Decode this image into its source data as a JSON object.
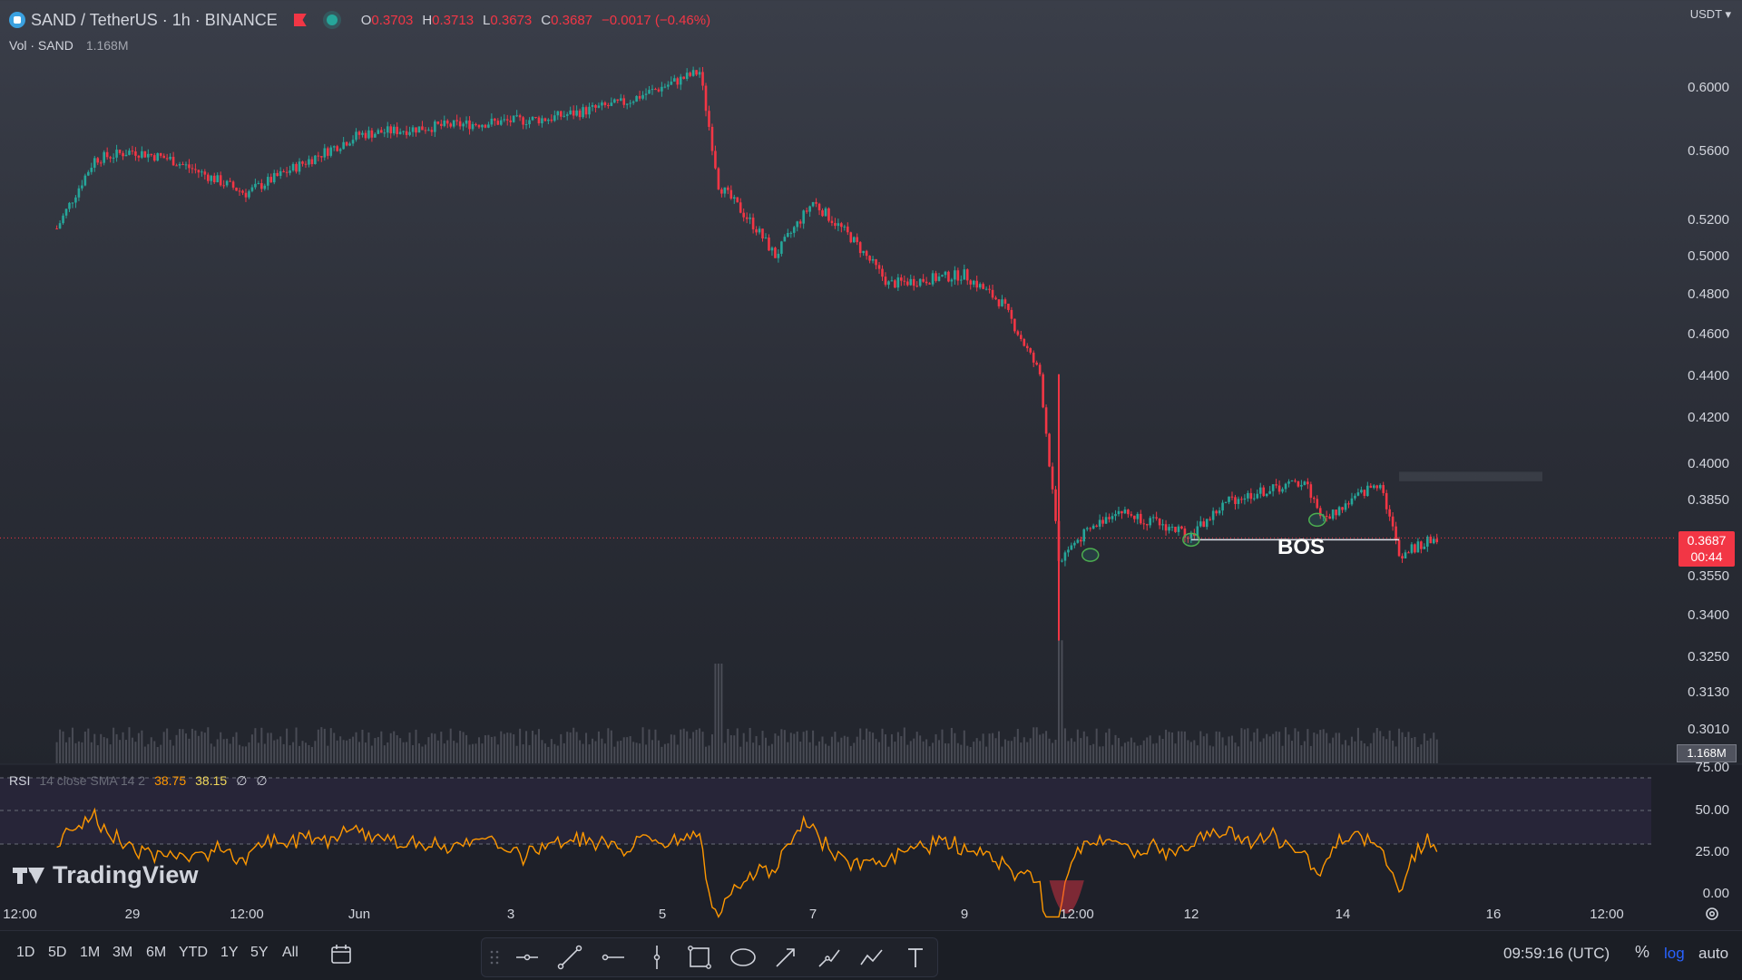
{
  "header": {
    "symbol": "SAND / TetherUS · 1h · BINANCE",
    "ohlc": [
      {
        "k": "O",
        "v": "0.3703"
      },
      {
        "k": "H",
        "v": "0.3713"
      },
      {
        "k": "L",
        "v": "0.3673"
      },
      {
        "k": "C",
        "v": "0.3687"
      }
    ],
    "change": "−0.0017 (−0.46%)",
    "vol_label": "Vol · SAND",
    "vol_value": "1.168M"
  },
  "currency": "USDT",
  "price_axis": {
    "ticks": [
      "0.6000",
      "0.5600",
      "0.5200",
      "0.5000",
      "0.4800",
      "0.4600",
      "0.4400",
      "0.4200",
      "0.4000",
      "0.3850",
      "0.3550",
      "0.3400",
      "0.3250",
      "0.3130",
      "0.3010"
    ],
    "current_price": "0.3687",
    "countdown": "00:44",
    "volume_badge": "1.168M"
  },
  "rsi": {
    "label": "RSI",
    "params": "14 close SMA 14 2",
    "value1": "38.75",
    "value2": "38.15",
    "value3": "∅",
    "value4": "∅",
    "ticks": [
      "75.00",
      "50.00",
      "25.00",
      "0.00"
    ]
  },
  "time_axis": [
    "12:00",
    "29",
    "12:00",
    "Jun",
    "3",
    "5",
    "7",
    "9",
    "12:00",
    "12",
    "14",
    "16",
    "12:00"
  ],
  "annotation": {
    "bos": "BOS"
  },
  "branding": "TradingView",
  "timeframes": [
    "1D",
    "5D",
    "1M",
    "3M",
    "6M",
    "YTD",
    "1Y",
    "5Y",
    "All"
  ],
  "clock": "09:59:16 (UTC)",
  "scale_opts": {
    "pct": "%",
    "log": "log",
    "auto": "auto"
  },
  "drawing_tools": [
    "drag-handle-icon",
    "horizontal-ray-icon",
    "trend-line-icon",
    "horizontal-line-icon",
    "vertical-line-icon",
    "rectangle-icon",
    "ellipse-icon",
    "arrow-icon",
    "path-icon",
    "polyline-icon",
    "text-icon"
  ],
  "colors": {
    "up": "#26a69a",
    "down": "#f23645",
    "rsi": "#ff9800",
    "bos": "#ffffff"
  },
  "chart_data": {
    "type": "candlestick",
    "price_key_points": [
      {
        "x": "May 28 00:00",
        "y": 0.515
      },
      {
        "x": "May 28 12:00",
        "y": 0.555
      },
      {
        "x": "May 29 00:00",
        "y": 0.56
      },
      {
        "x": "May 29 12:00",
        "y": 0.555
      },
      {
        "x": "May 30 12:00",
        "y": 0.535
      },
      {
        "x": "Jun 1 00:00",
        "y": 0.57
      },
      {
        "x": "Jun 2 00:00",
        "y": 0.575
      },
      {
        "x": "Jun 3 12:00",
        "y": 0.58
      },
      {
        "x": "Jun 4 12:00",
        "y": 0.59
      },
      {
        "x": "Jun 5 12:00",
        "y": 0.61
      },
      {
        "x": "Jun 5 18:00",
        "y": 0.54
      },
      {
        "x": "Jun 6 06:00",
        "y": 0.515
      },
      {
        "x": "Jun 6 12:00",
        "y": 0.5
      },
      {
        "x": "Jun 7 00:00",
        "y": 0.53
      },
      {
        "x": "Jun 7 12:00",
        "y": 0.51
      },
      {
        "x": "Jun 8 00:00",
        "y": 0.485
      },
      {
        "x": "Jun 9 00:00",
        "y": 0.49
      },
      {
        "x": "Jun 9 12:00",
        "y": 0.475
      },
      {
        "x": "Jun 10 00:00",
        "y": 0.44
      },
      {
        "x": "Jun 10 06:00",
        "y": 0.36
      },
      {
        "x": "Jun 10 12:00",
        "y": 0.368
      },
      {
        "x": "Jun 11 00:00",
        "y": 0.38
      },
      {
        "x": "Jun 12 00:00",
        "y": 0.37
      },
      {
        "x": "Jun 12 12:00",
        "y": 0.384
      },
      {
        "x": "Jun 13 12:00",
        "y": 0.392
      },
      {
        "x": "Jun 13 18:00",
        "y": 0.376
      },
      {
        "x": "Jun 14 12:00",
        "y": 0.392
      },
      {
        "x": "Jun 14 18:00",
        "y": 0.362
      },
      {
        "x": "Jun 15 06:00",
        "y": 0.3687
      }
    ],
    "bos_level": 0.368,
    "resistance_zone": [
      0.392,
      0.396
    ],
    "swing_points": [
      {
        "x": "Jun 10 16:00",
        "y": 0.362
      },
      {
        "x": "Jun 12 00:00",
        "y": 0.368
      },
      {
        "x": "Jun 13 16:00",
        "y": 0.376
      }
    ],
    "y_scale": "log",
    "rsi_range": [
      0,
      100
    ],
    "rsi_levels": [
      70,
      50,
      30
    ]
  }
}
